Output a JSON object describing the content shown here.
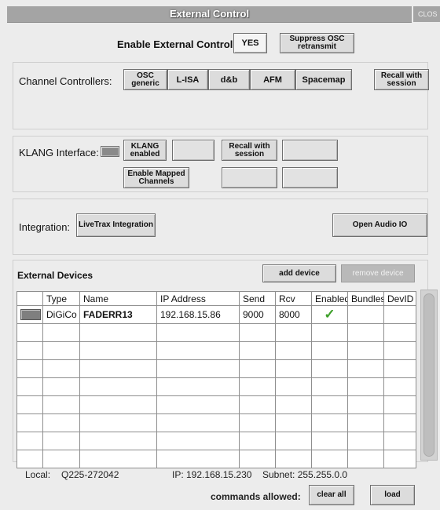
{
  "window": {
    "title": "External Control",
    "close_label": "CLOS"
  },
  "enable": {
    "label": "Enable External Control:",
    "yes_label": "YES",
    "suppress_label": "Suppress OSC retransmit"
  },
  "channel_controllers": {
    "label": "Channel Controllers:",
    "buttons": [
      "OSC generic",
      "L-ISA",
      "d&b",
      "AFM",
      "Spacemap"
    ],
    "recall_label": "Recall with session"
  },
  "klang": {
    "label": "KLANG Interface:",
    "enabled_label": "KLANG enabled",
    "recall_label": "Recall with session",
    "mapped_label": "Enable Mapped Channels"
  },
  "integration": {
    "label": "Integration:",
    "livetrax_label": "LiveTrax Integration",
    "open_audio_label": "Open Audio IO"
  },
  "external_devices": {
    "heading": "External Devices",
    "add_label": "add device",
    "remove_label": "remove device",
    "columns": [
      "",
      "Type",
      "Name",
      "IP Address",
      "Send",
      "Rcv",
      "Enabled",
      "Bundles",
      "DevID"
    ],
    "rows": [
      {
        "type": "DiGiCo",
        "name": "FADERR13",
        "ip": "192.168.15.86",
        "send": "9000",
        "rcv": "8000",
        "enabled": true
      }
    ],
    "check_icon": "checkmark-icon"
  },
  "footer": {
    "local_label": "Local:",
    "local_value": "Q225-272042",
    "ip_text": "IP: 192.168.15.230",
    "subnet_text": "Subnet: 255.255.0.0",
    "commands_label": "commands allowed:",
    "clear_label": "clear all",
    "load_label": "load"
  },
  "colors": {
    "titlebar": "#a4a4a4",
    "background": "#ececec",
    "check": "#3ea02a"
  }
}
